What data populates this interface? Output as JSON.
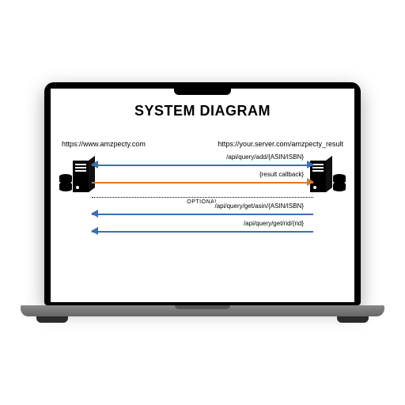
{
  "title": "SYSTEM DIAGRAM",
  "left_host": "https://www.amzpecty.com",
  "right_host": "https://your.server.com/amzpecty_result",
  "arrows": {
    "add": "/api/query/add/{ASIN/ISBN}",
    "callback": "{result callback}",
    "get_asin": "/api/query/get/asin/{ASIN/ISBN}",
    "get_rid": "/api/query/get/rid/{rid}"
  },
  "optional_label": "OPTIONAL"
}
